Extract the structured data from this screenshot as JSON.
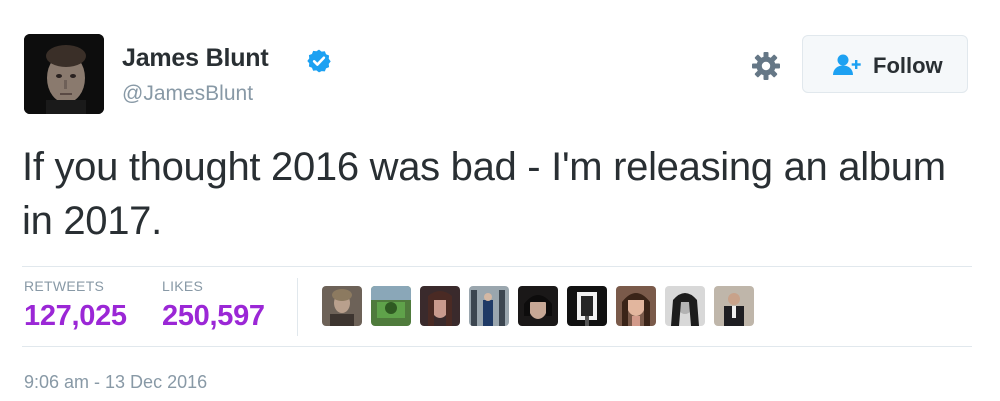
{
  "author": {
    "name": "James Blunt",
    "handle": "@JamesBlunt"
  },
  "icons": {
    "verified": "verified-badge-icon",
    "settings": "gear-icon",
    "follow": "add-user-icon"
  },
  "follow_button": {
    "label": "Follow"
  },
  "tweet": {
    "text": "If you thought 2016 was bad - I'm releasing an album in 2017."
  },
  "stats": {
    "retweets_label": "RETWEETS",
    "retweets_value": "127,025",
    "likes_label": "LIKES",
    "likes_value": "250,597"
  },
  "likers_count_shown": 9,
  "timestamp": "9:06 am - 13 Dec 2016",
  "colors": {
    "stat_value": "#9b27d6",
    "verified": "#1da1f2",
    "follow_icon": "#1da1f2",
    "muted_text": "#8899a6",
    "primary_text": "#292f33",
    "divider": "#e1e8ed"
  }
}
